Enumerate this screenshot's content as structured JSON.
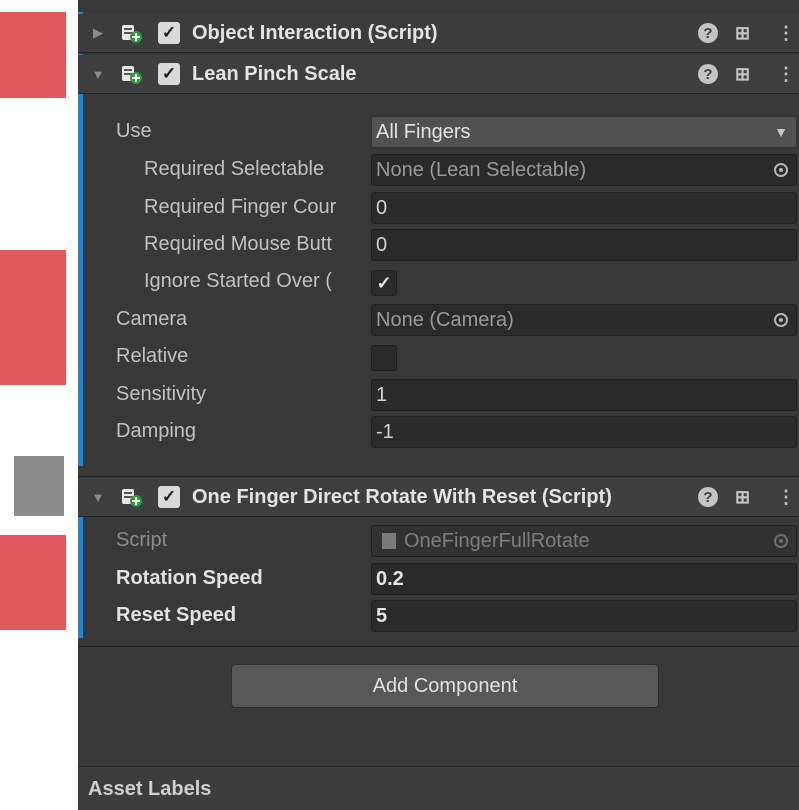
{
  "components": [
    {
      "title": "Object Interaction (Script)",
      "enabled": true,
      "expanded": false
    },
    {
      "title": "Lean Pinch Scale",
      "enabled": true,
      "expanded": true,
      "fields": {
        "use": {
          "label": "Use",
          "value": "All Fingers"
        },
        "required_selectable": {
          "label": "Required Selectable",
          "value": "None (Lean Selectable)"
        },
        "required_finger_count": {
          "label": "Required Finger Cour",
          "value": "0"
        },
        "required_mouse_buttons": {
          "label": "Required Mouse Butt",
          "value": "0"
        },
        "ignore_started_over_gui": {
          "label": "Ignore Started Over (",
          "checked": true
        },
        "camera": {
          "label": "Camera",
          "value": "None (Camera)"
        },
        "relative": {
          "label": "Relative",
          "checked": false
        },
        "sensitivity": {
          "label": "Sensitivity",
          "value": "1"
        },
        "damping": {
          "label": "Damping",
          "value": "-1"
        }
      }
    },
    {
      "title": "One Finger Direct Rotate With Reset (Script)",
      "enabled": true,
      "expanded": true,
      "fields": {
        "script": {
          "label": "Script",
          "value": "OneFingerFullRotate"
        },
        "rotation_speed": {
          "label": "Rotation Speed",
          "value": "0.2"
        },
        "reset_speed": {
          "label": "Reset Speed",
          "value": "5"
        }
      }
    }
  ],
  "add_component_label": "Add Component",
  "asset_labels_title": "Asset Labels",
  "icons": {
    "help": "help-icon",
    "presets": "presets-icon",
    "menu": "kebab-menu-icon",
    "object_picker": "object-picker-icon",
    "script_file": "script-file-icon",
    "component": "script-component-icon"
  },
  "colors": {
    "panel_bg": "#383838",
    "header_bg": "#3e3e3e",
    "field_bg": "#2a2a2a",
    "accent_blue": "#2f82c8",
    "button_bg": "#585858"
  }
}
